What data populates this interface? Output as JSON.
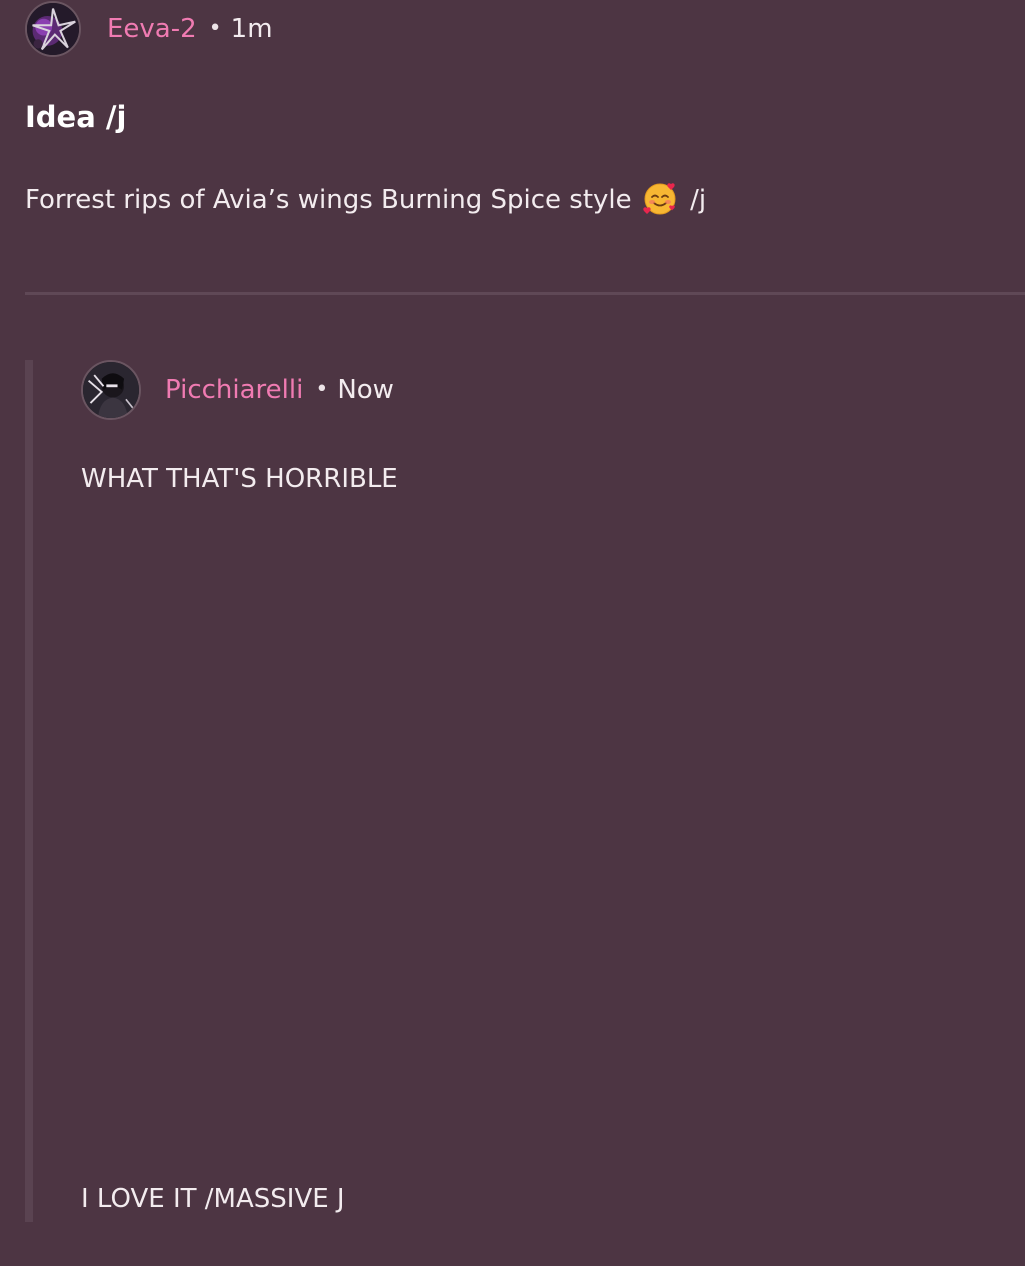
{
  "colors": {
    "background": "#4d3543",
    "username": "#f07bb2",
    "text": "#f3ecef",
    "divider": "#5f4856"
  },
  "post": {
    "author": "Eeva-2",
    "separator": "•",
    "time": "1m",
    "avatar_icon": "avatar-dark-purple-icon",
    "title": "Idea /j",
    "body_text": "Forrest rips of Avia’s wings Burning Spice style",
    "emoji_icon": "smiling-face-with-hearts-icon",
    "body_suffix": " /j"
  },
  "reply": {
    "author": "Picchiarelli",
    "separator": "•",
    "time": "Now",
    "avatar_icon": "avatar-dark-character-icon",
    "line_1": "WHAT THAT'S HORRIBLE",
    "line_2": "I LOVE IT /MASSIVE J"
  }
}
